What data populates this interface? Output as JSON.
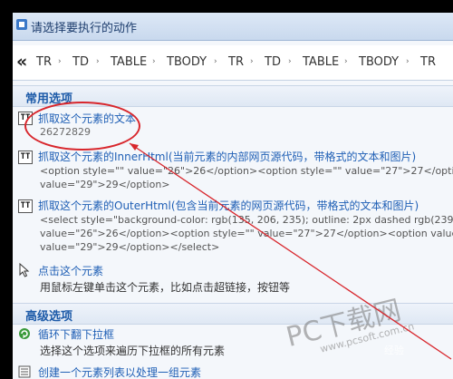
{
  "dialog": {
    "title": "请选择要执行的动作"
  },
  "breadcrumb": {
    "back": "«",
    "items": [
      "TR",
      "TD",
      "TABLE",
      "TBODY",
      "TR",
      "TD",
      "TABLE",
      "TBODY",
      "TR"
    ],
    "separator": "›"
  },
  "sections": {
    "common": "常用选项",
    "advanced": "高级选项"
  },
  "actions": {
    "extract_text": {
      "title": "抓取这个元素的文本",
      "value": "26272829"
    },
    "extract_inner": {
      "title": "抓取这个元素的InnerHtml(当前元素的内部网页源代码，带格式的文本和图片)",
      "line1": "<option style=\"\" value=\"26\">26</option><option style=\"\" value=\"27\">27</option><opt",
      "line2": "value=\"29\">29</option>"
    },
    "extract_outer": {
      "title": "抓取这个元素的OuterHtml(包含当前元素的网页源代码，带格式的文本和图片)",
      "line1": "<select style=\"background-color: rgb(135, 206, 235); outline: 2px dashed rgb(239, 91,",
      "line2": "value=\"26\">26</option><option style=\"\" value=\"27\">27</option><option value=\"28\"",
      "line3": "value=\"29\">29</option></select>"
    },
    "click": {
      "title": "点击这个元素",
      "desc": "用鼠标左键单击这个元素，比如点击超链接，按钮等"
    },
    "loop_dropdown": {
      "title": "循环下翻下拉框",
      "desc": "选择这个选项来遍历下拉框的所有元素"
    },
    "create_list": {
      "title": "创建一个元素列表以处理一组元素"
    }
  },
  "watermark": {
    "brand": "PC下载网",
    "url": "www.pcsoft.com.cn",
    "extra": "经验"
  },
  "colors": {
    "link_blue": "#1f5fb5",
    "section_blue": "#1c5aa8",
    "annotation_red": "#d8262c"
  }
}
